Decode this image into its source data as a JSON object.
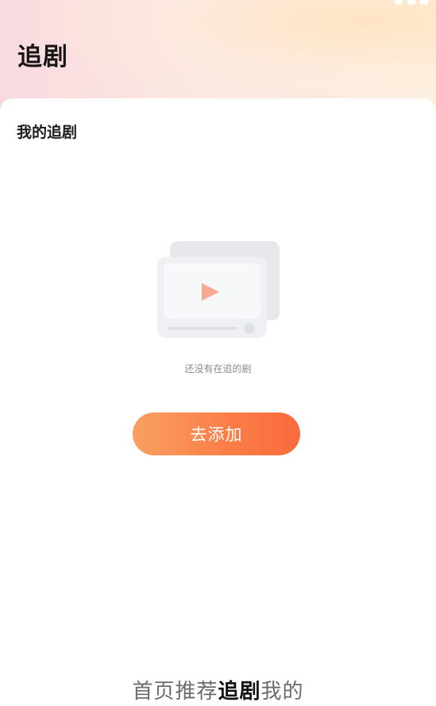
{
  "header": {
    "title": "追剧"
  },
  "section": {
    "title": "我的追剧"
  },
  "empty_state": {
    "illustration_icon": "video-play-icon",
    "message": "还没有在追的剧",
    "action_label": "去添加"
  },
  "tabs": [
    {
      "label": "首页",
      "active": false
    },
    {
      "label": "推荐",
      "active": false
    },
    {
      "label": "追剧",
      "active": true
    },
    {
      "label": "我的",
      "active": false
    }
  ],
  "colors": {
    "accent_start": "#f9a062",
    "accent_end": "#f96a3c",
    "play_icon": "#f6a98f",
    "illustration_back": "#e6e8ec",
    "illustration_front": "#f4f5f7"
  }
}
